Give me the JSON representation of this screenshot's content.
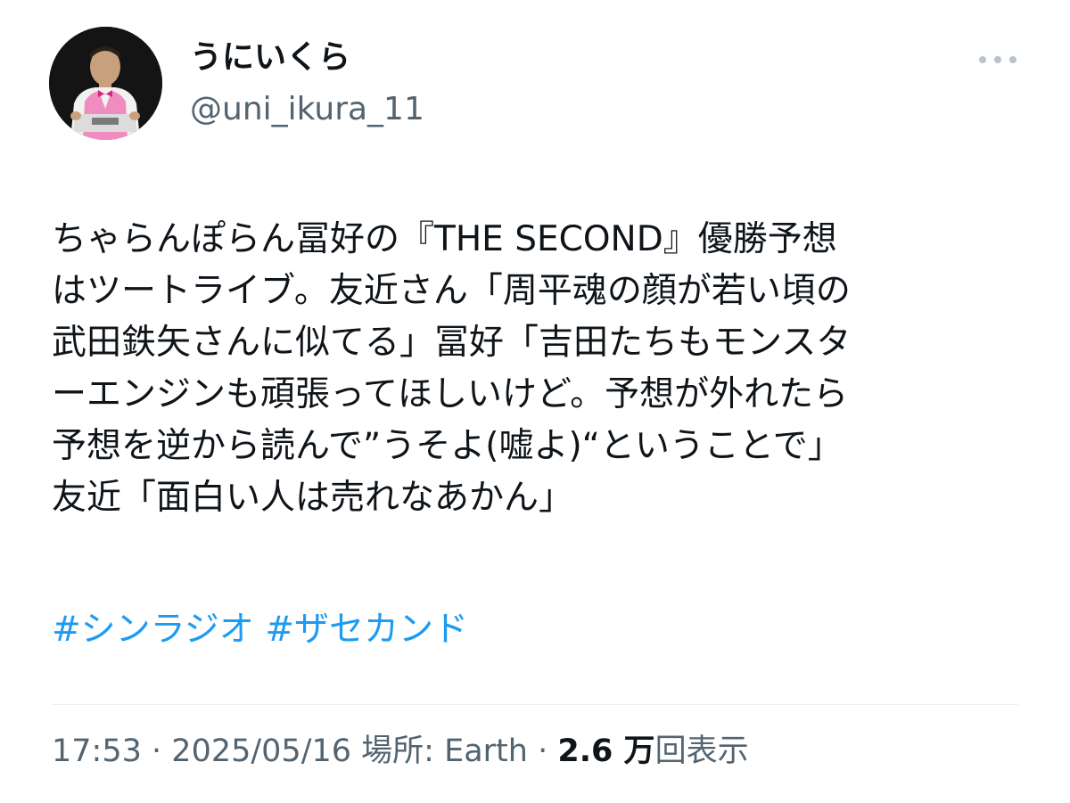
{
  "author": {
    "display_name": "うにいくら",
    "handle": "@uni_ikura_11"
  },
  "tweet": {
    "lines": [
      "ちゃらんぽらん冨好の『THE SECOND』優勝予想",
      "はツートライブ。友近さん「周平魂の顔が若い頃の",
      "武田鉄矢さんに似てる」冨好「吉田たちもモンスタ",
      "ーエンジンも頑張ってほしいけど。予想が外れたら",
      "予想を逆から読んで”うそよ(嘘よ)“ということで」",
      "友近「面白い人は売れなあかん」"
    ],
    "hashtags": [
      "#シンラジオ",
      "#ザセカンド"
    ]
  },
  "meta": {
    "time": "17:53",
    "date": "2025/05/16",
    "location": "場所: Earth",
    "separator": "·",
    "views_count": "2.6 万",
    "views_label": "回表示"
  },
  "menu": {
    "icon": "more-horizontal-icon"
  },
  "colors": {
    "hashtag": "#1d9bf0",
    "secondary_text": "#536471",
    "primary_text": "#0f1419",
    "avatar_vest": "#f08cc0"
  }
}
